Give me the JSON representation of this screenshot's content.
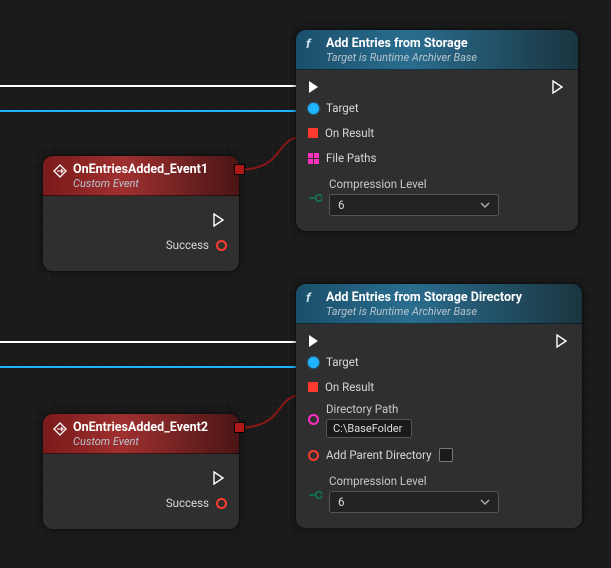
{
  "wires": {
    "execToA_color": "#ffffff",
    "targetToA_color": "#1fb4ff",
    "execToC_color": "#ffffff",
    "targetToC_color": "#1fb4ff",
    "delegateA_color": "#8a1616",
    "delegateC_color": "#8a1616"
  },
  "nodeA": {
    "title": "Add Entries from Storage",
    "subtitle": "Target is Runtime Archiver Base",
    "pins": {
      "target": "Target",
      "onResult": "On Result",
      "filePaths": "File Paths",
      "compressionLabel": "Compression Level",
      "compressionValue": "6"
    }
  },
  "nodeB": {
    "title": "OnEntriesAdded_Event1",
    "subtitle": "Custom Event",
    "pins": {
      "success": "Success"
    }
  },
  "nodeC": {
    "title": "Add Entries from Storage Directory",
    "subtitle": "Target is Runtime Archiver Base",
    "pins": {
      "target": "Target",
      "onResult": "On Result",
      "directoryLabel": "Directory Path",
      "directoryValue": "C:\\BaseFolder",
      "addParent": "Add Parent Directory",
      "compressionLabel": "Compression Level",
      "compressionValue": "6"
    }
  },
  "nodeD": {
    "title": "OnEntriesAdded_Event2",
    "subtitle": "Custom Event",
    "pins": {
      "success": "Success"
    }
  }
}
